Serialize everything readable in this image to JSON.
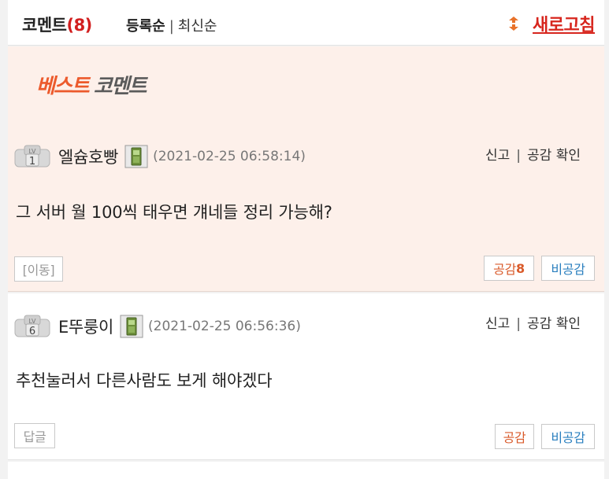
{
  "header": {
    "title": "코멘트",
    "count": "(8)",
    "sort_registered": "등록순",
    "sort_sep": "|",
    "sort_latest": "최신순",
    "refresh_label": "새로고침"
  },
  "best": {
    "logo_part1": "베스트",
    "logo_part2": "코멘트"
  },
  "comments": [
    {
      "level": "1",
      "nick": "엘슘호빵",
      "date": "(2021-02-25 06:58:14)",
      "report": "신고",
      "sep": "|",
      "confirm": "공감 확인",
      "text": "그 서버 월 100씩 태우면 걔네들 정리 가능해?",
      "left_button": "[이동]",
      "like_label": "공감",
      "like_count": "8",
      "dislike_label": "비공감"
    },
    {
      "level": "6",
      "nick": "E뚜룽이",
      "date": "(2021-02-25 06:56:36)",
      "report": "신고",
      "sep": "|",
      "confirm": "공감 확인",
      "text": "추천눌러서 다른사람도 보게 해야겠다",
      "left_button": "답글",
      "like_label": "공감",
      "like_count": "",
      "dislike_label": "비공감"
    }
  ],
  "colors": {
    "accent_red": "#d7261e",
    "like_orange": "#d95a2a",
    "dislike_blue": "#2a7fbf",
    "best_bg": "#fdf0ea"
  }
}
